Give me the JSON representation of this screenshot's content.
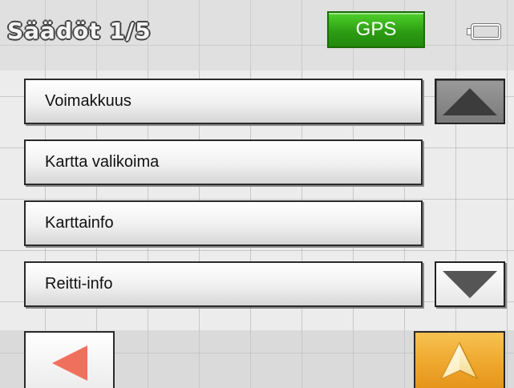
{
  "header": {
    "title": "Säädöt 1/5",
    "gps_label": "GPS"
  },
  "menu": {
    "items": [
      {
        "label": "Voimakkuus"
      },
      {
        "label": "Kartta valikoima"
      },
      {
        "label": "Karttainfo"
      },
      {
        "label": "Reitti-info"
      }
    ]
  },
  "icons": {
    "scroll_up": "triangle-up-icon",
    "scroll_down": "triangle-down-icon",
    "back": "arrow-left-icon",
    "navigate": "navigation-arrow-icon",
    "battery": "battery-icon"
  },
  "colors": {
    "gps": "#2b9a12",
    "back_arrow": "#f0705e",
    "navigate_button": "#eea52b"
  }
}
